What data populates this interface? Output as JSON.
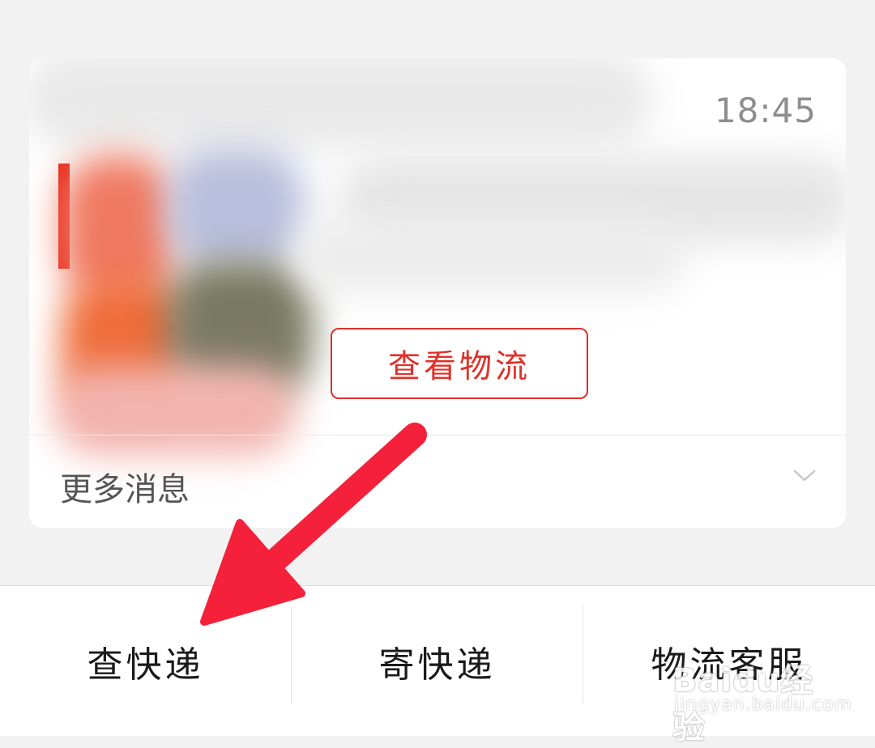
{
  "message_card": {
    "time": "18:45",
    "logistics_button_label": "查看物流",
    "more_messages_label": "更多消息"
  },
  "tabbar": {
    "tabs": [
      {
        "label": "查快递"
      },
      {
        "label": "寄快递"
      },
      {
        "label": "物流客服"
      }
    ]
  },
  "annotation": {
    "arrow_color": "#f5213a"
  },
  "watermark": {
    "brand": "Baidu经验",
    "url": "jingyan.baidu.com"
  },
  "colors": {
    "accent_red": "#e0302a",
    "background": "#f2f2f2"
  }
}
